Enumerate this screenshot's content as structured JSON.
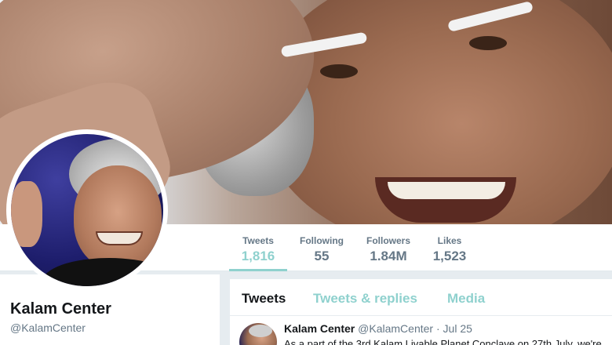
{
  "profile": {
    "name": "Kalam Center",
    "handle": "@KalamCenter"
  },
  "stats": [
    {
      "label": "Tweets",
      "value": "1,816"
    },
    {
      "label": "Following",
      "value": "55"
    },
    {
      "label": "Followers",
      "value": "1.84M"
    },
    {
      "label": "Likes",
      "value": "1,523"
    }
  ],
  "tabs": [
    {
      "label": "Tweets"
    },
    {
      "label": "Tweets & replies"
    },
    {
      "label": "Media"
    }
  ],
  "tweet": {
    "author": "Kalam Center",
    "handle": "@KalamCenter",
    "separator": "·",
    "date": "Jul 25",
    "text": "As a part of the 3rd Kalam Livable Planet Conclave on 27th July, we're"
  },
  "colors": {
    "accent": "#8fd1ce",
    "text_primary": "#14171a",
    "text_secondary": "#657786",
    "background": "#e6ecf0"
  }
}
